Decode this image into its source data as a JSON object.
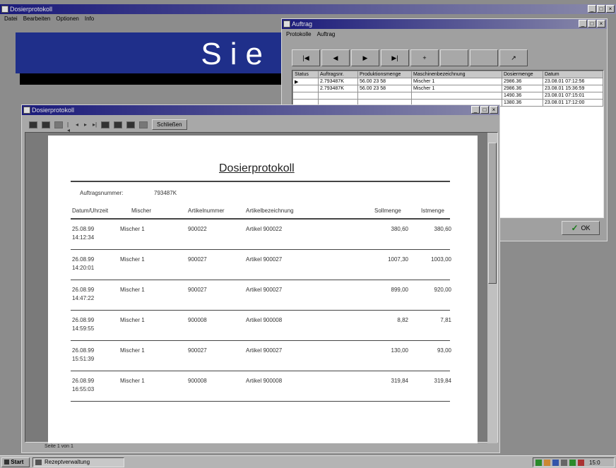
{
  "main_window": {
    "title": "Dosierprotokoll",
    "menu": [
      "Datei",
      "Bearbeiten",
      "Optionen",
      "Info"
    ],
    "banner_text": "Sie"
  },
  "grid_window": {
    "title": "Auftrag",
    "menu": [
      "Protokolle",
      "Auftrag"
    ],
    "nav_buttons": [
      "|◀",
      "◀",
      "▶",
      "▶|",
      "+",
      "",
      "",
      "↗"
    ],
    "columns": [
      "Status",
      "Auftragsnr.",
      "Produktionsmenge",
      "Maschinenbezeichnung",
      "Dosiermenge",
      "Datum"
    ],
    "rows": [
      [
        "▶",
        "2.793487K",
        "56.00 23 58",
        "Mischer 1",
        "2986.36",
        "23.08.01 07:12:56"
      ],
      [
        "",
        "2.793487K",
        "56.00 23 58",
        "Mischer 1",
        "2986.36",
        "23.08.01 15:36:59"
      ],
      [
        "",
        "",
        "",
        "",
        "1490.36",
        "23.08.01 07:15:01"
      ],
      [
        "",
        "",
        "",
        "",
        "1380.36",
        "23.08.01 17:12:00"
      ]
    ],
    "ok_label": "OK"
  },
  "report_window": {
    "title": "Dosierprotokoll",
    "toolbar_button": "Schließen",
    "status": "Seite 1 von 1"
  },
  "report": {
    "title": "Dosierprotokoll",
    "order_label": "Auftragsnummer:",
    "order_value": "793487K",
    "headers": [
      "Datum/Uhrzeit",
      "Mischer",
      "Artikelnummer",
      "Artikelbezeichnung",
      "Sollmenge",
      "Istmenge"
    ],
    "rows": [
      {
        "date": "25.08.99",
        "time": "14:12:34",
        "mixer": "Mischer 1",
        "article": "900022",
        "desc": "Artikel 900022",
        "soll": "380,60",
        "ist": "380,60"
      },
      {
        "date": "26.08.99",
        "time": "14:20:01",
        "mixer": "Mischer 1",
        "article": "900027",
        "desc": "Artikel 900027",
        "soll": "1007,30",
        "ist": "1003,00"
      },
      {
        "date": "26.08.99",
        "time": "14:47:22",
        "mixer": "Mischer 1",
        "article": "900027",
        "desc": "Artikel 900027",
        "soll": "899,00",
        "ist": "920,00"
      },
      {
        "date": "26.08.99",
        "time": "14:59:55",
        "mixer": "Mischer 1",
        "article": "900008",
        "desc": "Artikel 900008",
        "soll": "8,82",
        "ist": "7,81"
      },
      {
        "date": "26.08.99",
        "time": "15:51:39",
        "mixer": "Mischer 1",
        "article": "900027",
        "desc": "Artikel 900027",
        "soll": "130,00",
        "ist": "93,00"
      },
      {
        "date": "26.08.99",
        "time": "16:55:03",
        "mixer": "Mischer 1",
        "article": "900008",
        "desc": "Artikel 900008",
        "soll": "319,84",
        "ist": "319,84"
      }
    ]
  },
  "taskbar": {
    "start": "Start",
    "task": "Rezeptverwaltung",
    "clock": "15:0"
  }
}
